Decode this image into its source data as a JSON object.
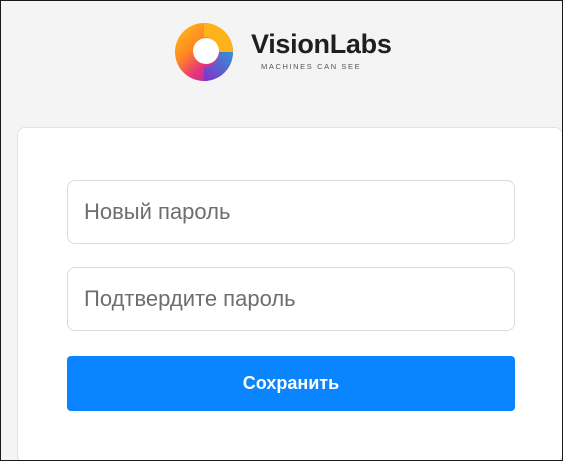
{
  "logo": {
    "name": "VisionLabs",
    "tagline": "MACHINES CAN SEE",
    "icon": "visionlabs-ring-icon",
    "colors": [
      "#7b2fd0",
      "#e8347a",
      "#ff8a1f",
      "#ffc21a",
      "#1aa3e0"
    ]
  },
  "form": {
    "new_password": {
      "placeholder": "Новый пароль",
      "value": ""
    },
    "confirm_password": {
      "placeholder": "Подтвердите пароль",
      "value": ""
    },
    "save_label": "Сохранить"
  },
  "colors": {
    "accent": "#0a84ff",
    "background": "#f4f4f4",
    "card": "#ffffff"
  }
}
